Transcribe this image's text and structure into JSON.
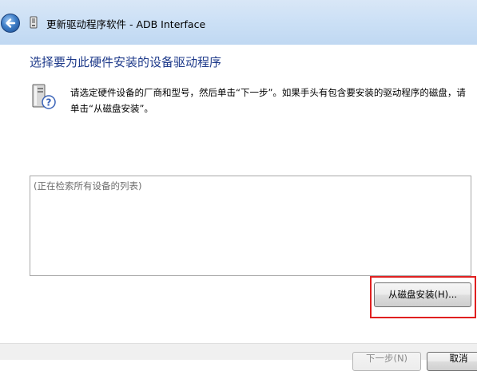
{
  "window": {
    "title": "更新驱动程序软件 - ADB Interface",
    "back_icon": "back-arrow-icon",
    "device_icon": "device-icon"
  },
  "main": {
    "heading": "选择要为此硬件安装的设备驱动程序",
    "info_icon": "hardware-question-icon",
    "info_text": "请选定硬件设备的厂商和型号，然后单击“下一步”。如果手头有包含要安装的驱动程序的磁盘，请单击“从磁盘安装”。",
    "device_list": {
      "placeholder": "(正在检索所有设备的列表)"
    },
    "have_disk_button": "从磁盘安装(H)..."
  },
  "footer": {
    "next_button": "下一步(N)",
    "cancel_button": "取消"
  },
  "colors": {
    "heading": "#1e3a8a",
    "titlebar": "#cadff5",
    "highlight": "#e02020"
  }
}
